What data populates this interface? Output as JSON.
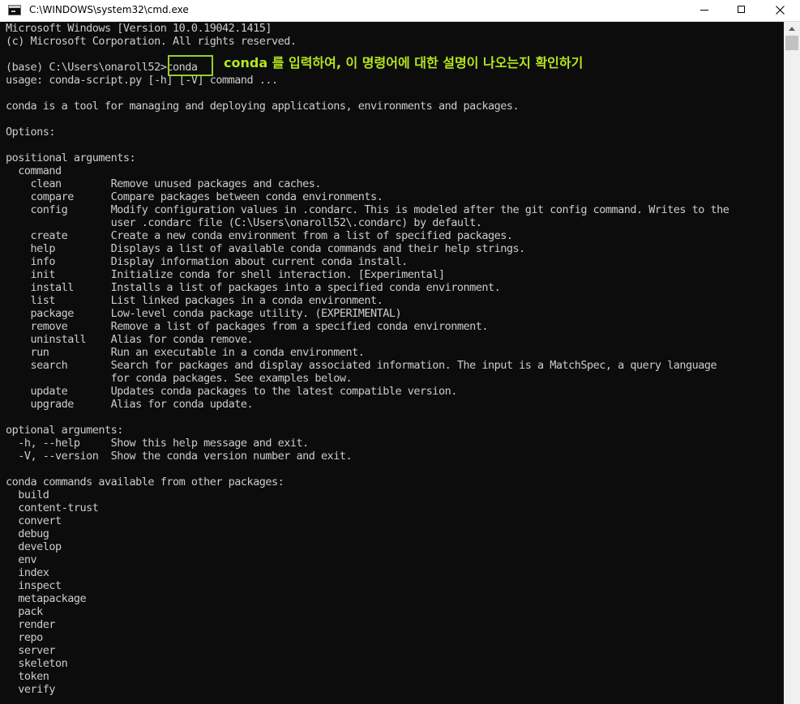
{
  "window": {
    "title": "C:\\WINDOWS\\system32\\cmd.exe",
    "controls": {
      "close_glyph": "✕"
    }
  },
  "annotation": "conda 를 입력하여, 이 명령어에 대한 설명이 나오는지 확인하기",
  "console_lines": [
    "Microsoft Windows [Version 10.0.19042.1415]",
    "(c) Microsoft Corporation. All rights reserved.",
    "",
    "(base) C:\\Users\\onaroll52>conda",
    "usage: conda-script.py [-h] [-V] command ...",
    "",
    "conda is a tool for managing and deploying applications, environments and packages.",
    "",
    "Options:",
    "",
    "positional arguments:",
    "  command",
    "    clean        Remove unused packages and caches.",
    "    compare      Compare packages between conda environments.",
    "    config       Modify configuration values in .condarc. This is modeled after the git config command. Writes to the",
    "                 user .condarc file (C:\\Users\\onaroll52\\.condarc) by default.",
    "    create       Create a new conda environment from a list of specified packages.",
    "    help         Displays a list of available conda commands and their help strings.",
    "    info         Display information about current conda install.",
    "    init         Initialize conda for shell interaction. [Experimental]",
    "    install      Installs a list of packages into a specified conda environment.",
    "    list         List linked packages in a conda environment.",
    "    package      Low-level conda package utility. (EXPERIMENTAL)",
    "    remove       Remove a list of packages from a specified conda environment.",
    "    uninstall    Alias for conda remove.",
    "    run          Run an executable in a conda environment.",
    "    search       Search for packages and display associated information. The input is a MatchSpec, a query language",
    "                 for conda packages. See examples below.",
    "    update       Updates conda packages to the latest compatible version.",
    "    upgrade      Alias for conda update.",
    "",
    "optional arguments:",
    "  -h, --help     Show this help message and exit.",
    "  -V, --version  Show the conda version number and exit.",
    "",
    "conda commands available from other packages:",
    "  build",
    "  content-trust",
    "  convert",
    "  debug",
    "  develop",
    "  env",
    "  index",
    "  inspect",
    "  metapackage",
    "  pack",
    "  render",
    "  repo",
    "  server",
    "  skeleton",
    "  token",
    "  verify"
  ],
  "colors": {
    "console_bg": "#0c0c0c",
    "console_text": "#cccccc",
    "highlight": "#9ccc28",
    "annotation": "#b5e61d"
  }
}
